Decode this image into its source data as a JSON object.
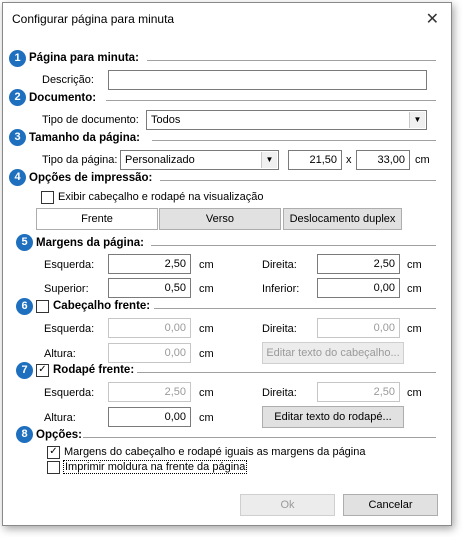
{
  "window": {
    "title": "Configurar página para minuta"
  },
  "sections": {
    "s1": {
      "num": "1",
      "title": "Página para minuta:"
    },
    "s2": {
      "num": "2",
      "title": "Documento:"
    },
    "s3": {
      "num": "3",
      "title": "Tamanho da página:"
    },
    "s4": {
      "num": "4",
      "title": "Opções de impressão:"
    },
    "s5": {
      "num": "5",
      "title": "Margens da página:"
    },
    "s6": {
      "num": "6",
      "title": "Cabeçalho frente:"
    },
    "s7": {
      "num": "7",
      "title": "Rodapé frente:"
    },
    "s8": {
      "num": "8",
      "title": "Opções:"
    }
  },
  "pagina": {
    "descricao_label": "Descrição:",
    "descricao_value": ""
  },
  "documento": {
    "tipo_label": "Tipo de documento:",
    "tipo_value": "Todos"
  },
  "tamanho": {
    "tipo_label": "Tipo da página:",
    "tipo_value": "Personalizado",
    "width": "21,50",
    "times": "x",
    "height": "33,00",
    "unit": "cm"
  },
  "impressao": {
    "exibir_label": "Exibir cabeçalho e rodapé na visualização",
    "exibir_checked": false,
    "tabs": [
      "Frente",
      "Verso",
      "Deslocamento duplex"
    ]
  },
  "margens": {
    "esquerda_label": "Esquerda:",
    "esquerda": "2,50",
    "direita_label": "Direita:",
    "direita": "2,50",
    "superior_label": "Superior:",
    "superior": "0,50",
    "inferior_label": "Inferior:",
    "inferior": "0,00",
    "unit": "cm"
  },
  "cabecalho": {
    "checked": false,
    "esquerda_label": "Esquerda:",
    "esquerda": "0,00",
    "direita_label": "Direita:",
    "direita": "0,00",
    "altura_label": "Altura:",
    "altura": "0,00",
    "edit_button": "Editar texto do cabeçalho...",
    "unit": "cm"
  },
  "rodape": {
    "checked": true,
    "esquerda_label": "Esquerda:",
    "esquerda": "2,50",
    "direita_label": "Direita:",
    "direita": "2,50",
    "altura_label": "Altura:",
    "altura": "0,00",
    "edit_button": "Editar texto do rodapé...",
    "unit": "cm"
  },
  "opcoes": {
    "opt1_label": "Margens do cabeçalho e rodapé iguais as margens da página",
    "opt1_checked": true,
    "opt2_label": "Imprimir moldura na frente da página",
    "opt2_checked": false
  },
  "footer": {
    "ok": "Ok",
    "cancel": "Cancelar"
  },
  "icons": {
    "close": "close-icon",
    "checkmark": "✓",
    "dropdown": "▼"
  },
  "colors": {
    "badge": "#1f6fbf"
  }
}
